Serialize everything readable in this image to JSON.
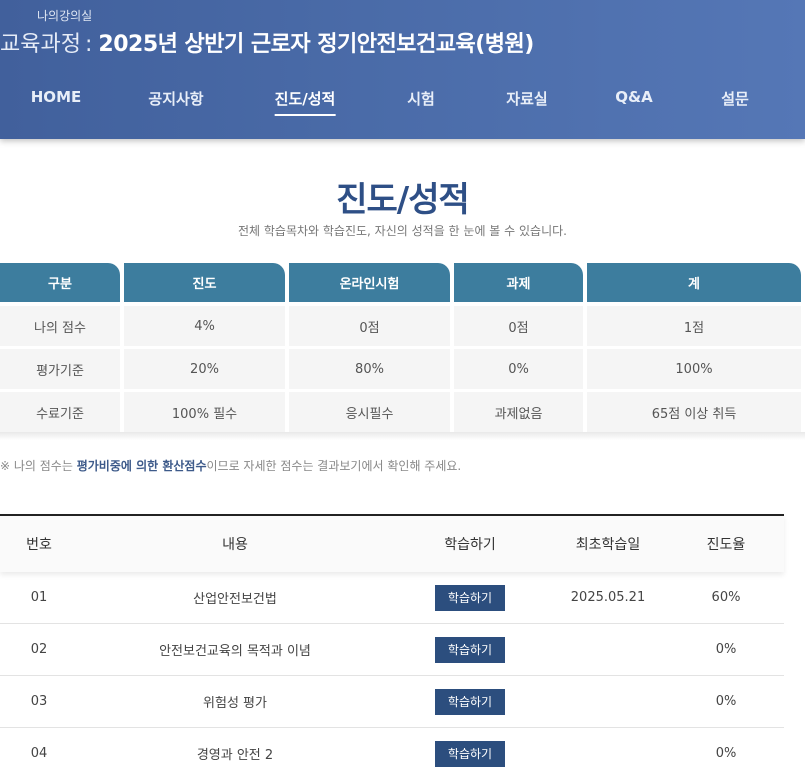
{
  "header": {
    "lecture_room": "나의강의실",
    "course_prefix": "교육과정",
    "course_colon": ":",
    "course_title": "2025년 상반기 근로자 정기안전보건교육(병원)"
  },
  "nav": [
    "HOME",
    "공지사항",
    "진도/성적",
    "시험",
    "자료실",
    "Q&A",
    "설문"
  ],
  "nav_active": "진도/성적",
  "page": {
    "title": "진도/성적",
    "subtitle": "전체 학습목차와 학습진도, 자신의 성적을 한 눈에 볼 수 있습니다."
  },
  "score_table": {
    "headers": [
      "구분",
      "진도",
      "온라인시험",
      "과제",
      "계"
    ],
    "rows": [
      [
        "나의 점수",
        "4%",
        "0점",
        "0점",
        "1점"
      ],
      [
        "평가기준",
        "20%",
        "80%",
        "0%",
        "100%"
      ],
      [
        "수료기준",
        "100% 필수",
        "응시필수",
        "과제없음",
        "65점 이상 취득"
      ]
    ]
  },
  "note": {
    "prefix": "※ 나의 점수는 ",
    "highlight": "평가비중에 의한 환산점수",
    "suffix": "이므로 자세한 점수는 결과보기에서 확인해 주세요."
  },
  "lesson_table": {
    "headers": [
      "번호",
      "내용",
      "학습하기",
      "최초학습일",
      "진도율"
    ],
    "button_label": "학습하기",
    "rows": [
      {
        "no": "01",
        "title": "산업안전보건법",
        "first_date": "2025.05.21",
        "progress": "60%"
      },
      {
        "no": "02",
        "title": "안전보건교육의 목적과 이념",
        "first_date": "",
        "progress": "0%"
      },
      {
        "no": "03",
        "title": "위험성 평가",
        "first_date": "",
        "progress": "0%"
      },
      {
        "no": "04",
        "title": "경영과 안전 2",
        "first_date": "",
        "progress": "0%"
      }
    ]
  },
  "colors": {
    "header_bg": "#4a6ba8",
    "table_header_bg": "#3d7d9e",
    "button_bg": "#2c4e7e",
    "title_color": "#2e4f86"
  }
}
